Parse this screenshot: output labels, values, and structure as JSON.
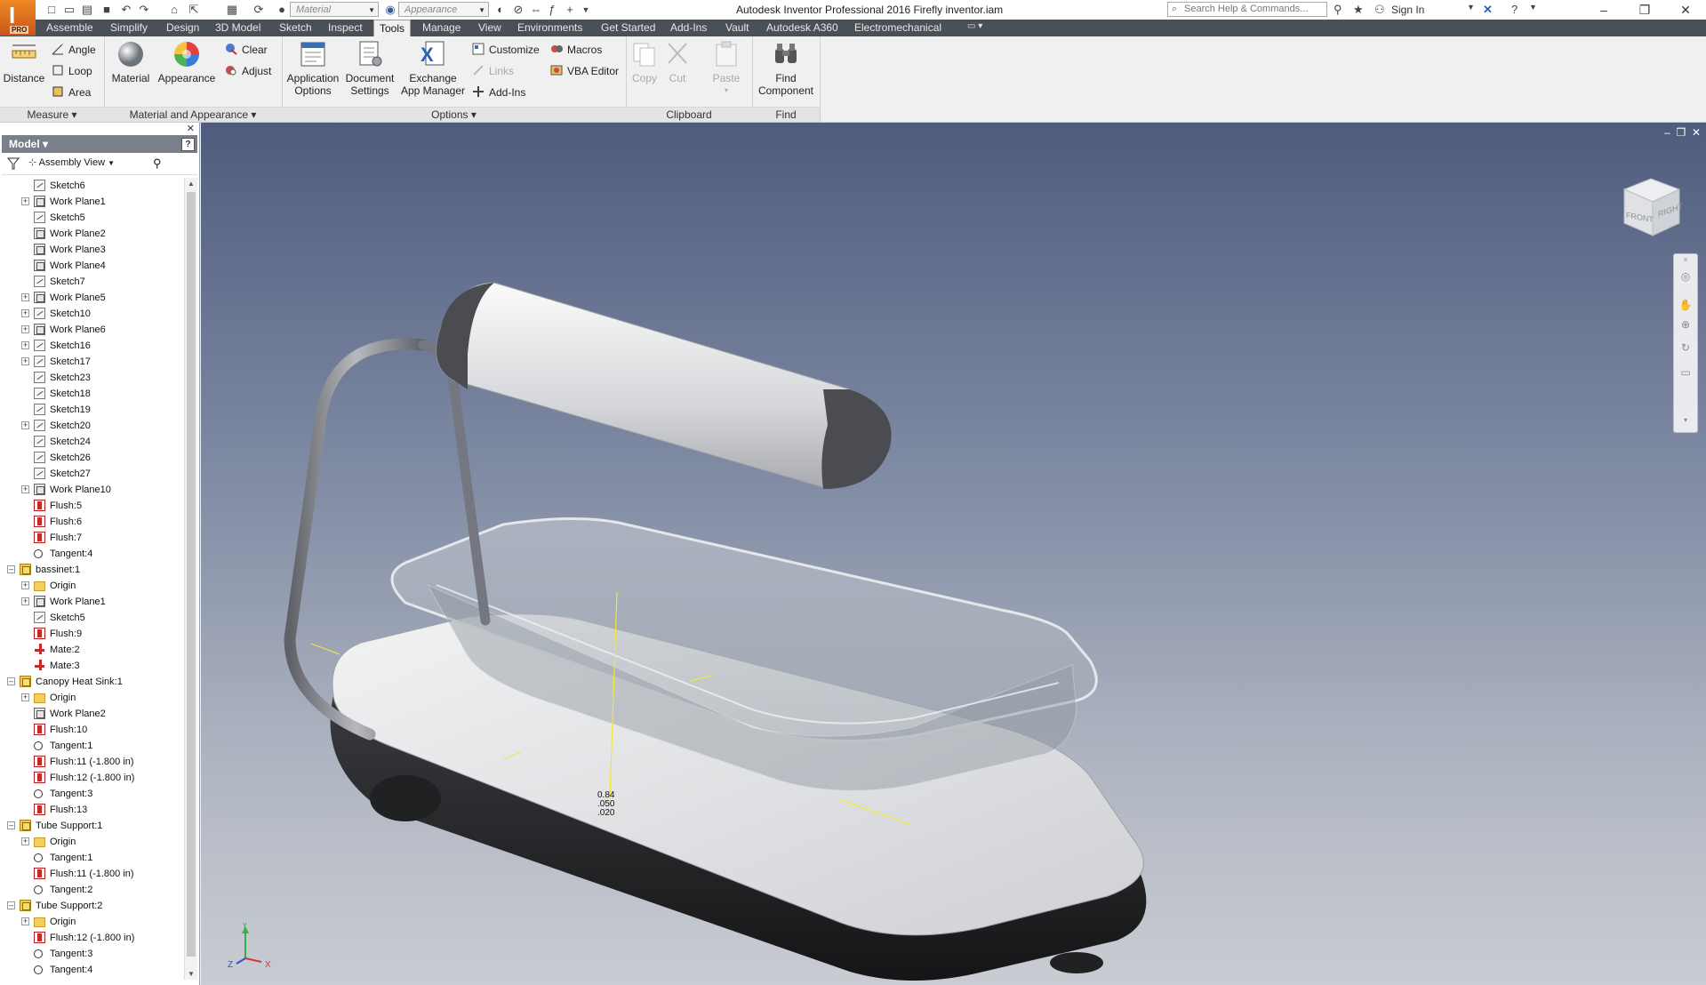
{
  "title_bar": {
    "app_title": "Autodesk Inventor Professional 2016   Firefly inventor.iam",
    "logo_letter": "I",
    "logo_badge": "PRO",
    "material_combo": "Material",
    "appearance_combo": "Appearance",
    "search_placeholder": "Search Help & Commands...",
    "sign_in": "Sign In"
  },
  "tabs": [
    {
      "label": "Assemble"
    },
    {
      "label": "Simplify"
    },
    {
      "label": "Design"
    },
    {
      "label": "3D Model"
    },
    {
      "label": "Sketch"
    },
    {
      "label": "Inspect"
    },
    {
      "label": "Tools"
    },
    {
      "label": "Manage"
    },
    {
      "label": "View"
    },
    {
      "label": "Environments"
    },
    {
      "label": "Get Started"
    },
    {
      "label": "Add-Ins"
    },
    {
      "label": "Vault"
    },
    {
      "label": "Autodesk A360"
    },
    {
      "label": "Electromechanical"
    }
  ],
  "active_tab": "Tools",
  "ribbon": {
    "measure": {
      "title": "Measure",
      "distance": "Distance",
      "angle": "Angle",
      "loop": "Loop",
      "area": "Area"
    },
    "material_appearance": {
      "title": "Material and Appearance",
      "material": "Material",
      "appearance": "Appearance",
      "clear": "Clear",
      "adjust": "Adjust"
    },
    "options": {
      "title": "Options",
      "application_options_1": "Application",
      "application_options_2": "Options",
      "document_settings_1": "Document",
      "document_settings_2": "Settings",
      "exchange_1": "Exchange",
      "exchange_2": "App Manager",
      "customize": "Customize",
      "links": "Links",
      "addins": "Add-Ins",
      "macros": "Macros",
      "vba": "VBA Editor"
    },
    "clipboard": {
      "title": "Clipboard",
      "copy": "Copy",
      "cut": "Cut",
      "paste": "Paste"
    },
    "find": {
      "title": "Find",
      "find_1": "Find",
      "find_2": "Component"
    }
  },
  "browser": {
    "header": "Model",
    "view": "Assembly View",
    "tree": [
      {
        "label": "Sketch6",
        "icon": "sketch",
        "indent": 1,
        "expand": false
      },
      {
        "label": "Work Plane1",
        "icon": "plane",
        "indent": 1,
        "expand": true
      },
      {
        "label": "Sketch5",
        "icon": "sketch",
        "indent": 1,
        "expand": false
      },
      {
        "label": "Work Plane2",
        "icon": "plane",
        "indent": 1,
        "expand": false
      },
      {
        "label": "Work Plane3",
        "icon": "plane",
        "indent": 1,
        "expand": false
      },
      {
        "label": "Work Plane4",
        "icon": "plane",
        "indent": 1,
        "expand": false
      },
      {
        "label": "Sketch7",
        "icon": "sketch",
        "indent": 1,
        "expand": false
      },
      {
        "label": "Work Plane5",
        "icon": "plane",
        "indent": 1,
        "expand": true
      },
      {
        "label": "Sketch10",
        "icon": "sketch",
        "indent": 1,
        "expand": true
      },
      {
        "label": "Work Plane6",
        "icon": "plane",
        "indent": 1,
        "expand": true
      },
      {
        "label": "Sketch16",
        "icon": "sketch",
        "indent": 1,
        "expand": true
      },
      {
        "label": "Sketch17",
        "icon": "sketch",
        "indent": 1,
        "expand": true
      },
      {
        "label": "Sketch23",
        "icon": "sketch",
        "indent": 1,
        "expand": false
      },
      {
        "label": "Sketch18",
        "icon": "sketch",
        "indent": 1,
        "expand": false
      },
      {
        "label": "Sketch19",
        "icon": "sketch",
        "indent": 1,
        "expand": false
      },
      {
        "label": "Sketch20",
        "icon": "sketch",
        "indent": 1,
        "expand": true
      },
      {
        "label": "Sketch24",
        "icon": "sketch",
        "indent": 1,
        "expand": false
      },
      {
        "label": "Sketch26",
        "icon": "sketch",
        "indent": 1,
        "expand": false
      },
      {
        "label": "Sketch27",
        "icon": "sketch",
        "indent": 1,
        "expand": false
      },
      {
        "label": "Work Plane10",
        "icon": "plane",
        "indent": 1,
        "expand": true
      },
      {
        "label": "Flush:5",
        "icon": "flush",
        "indent": 1,
        "expand": false
      },
      {
        "label": "Flush:6",
        "icon": "flush",
        "indent": 1,
        "expand": false
      },
      {
        "label": "Flush:7",
        "icon": "flush",
        "indent": 1,
        "expand": false
      },
      {
        "label": "Tangent:4",
        "icon": "tangent",
        "indent": 1,
        "expand": false
      },
      {
        "label": "bassinet:1",
        "icon": "part",
        "indent": 0,
        "expand": "minus"
      },
      {
        "label": "Origin",
        "icon": "folder",
        "indent": 1,
        "expand": true
      },
      {
        "label": "Work Plane1",
        "icon": "plane",
        "indent": 1,
        "expand": true
      },
      {
        "label": "Sketch5",
        "icon": "sketch",
        "indent": 1,
        "expand": false
      },
      {
        "label": "Flush:9",
        "icon": "flush",
        "indent": 1,
        "expand": false
      },
      {
        "label": "Mate:2",
        "icon": "mate",
        "indent": 1,
        "expand": false
      },
      {
        "label": "Mate:3",
        "icon": "mate",
        "indent": 1,
        "expand": false
      },
      {
        "label": "Canopy Heat Sink:1",
        "icon": "part",
        "indent": 0,
        "expand": "minus"
      },
      {
        "label": "Origin",
        "icon": "folder",
        "indent": 1,
        "expand": true
      },
      {
        "label": "Work Plane2",
        "icon": "plane",
        "indent": 1,
        "expand": false
      },
      {
        "label": "Flush:10",
        "icon": "flush",
        "indent": 1,
        "expand": false
      },
      {
        "label": "Tangent:1",
        "icon": "tangent",
        "indent": 1,
        "expand": false
      },
      {
        "label": "Flush:11 (-1.800 in)",
        "icon": "flush",
        "indent": 1,
        "expand": false
      },
      {
        "label": "Flush:12 (-1.800 in)",
        "icon": "flush",
        "indent": 1,
        "expand": false
      },
      {
        "label": "Tangent:3",
        "icon": "tangent",
        "indent": 1,
        "expand": false
      },
      {
        "label": "Flush:13",
        "icon": "flush",
        "indent": 1,
        "expand": false
      },
      {
        "label": "Tube Support:1",
        "icon": "part",
        "indent": 0,
        "expand": "minus"
      },
      {
        "label": "Origin",
        "icon": "folder",
        "indent": 1,
        "expand": true
      },
      {
        "label": "Tangent:1",
        "icon": "tangent",
        "indent": 1,
        "expand": false
      },
      {
        "label": "Flush:11 (-1.800 in)",
        "icon": "flush",
        "indent": 1,
        "expand": false
      },
      {
        "label": "Tangent:2",
        "icon": "tangent",
        "indent": 1,
        "expand": false
      },
      {
        "label": "Tube Support:2",
        "icon": "part",
        "indent": 0,
        "expand": "minus"
      },
      {
        "label": "Origin",
        "icon": "folder",
        "indent": 1,
        "expand": true
      },
      {
        "label": "Flush:12 (-1.800 in)",
        "icon": "flush",
        "indent": 1,
        "expand": false
      },
      {
        "label": "Tangent:3",
        "icon": "tangent",
        "indent": 1,
        "expand": false
      },
      {
        "label": "Tangent:4",
        "icon": "tangent",
        "indent": 1,
        "expand": false
      }
    ]
  },
  "viewport": {
    "viewcube_front": "FRONT",
    "viewcube_right": "RIGHT",
    "dimension_text": [
      "0.84",
      ".050",
      ".020"
    ],
    "axis_labels": {
      "x": "X",
      "y": "Y",
      "z": "Z"
    }
  },
  "colors": {
    "tab_bar": "#4b4f56",
    "accent_orange": "#f08a24",
    "browser_header": "#7a8089",
    "viewport_top": "#4f5c7d",
    "viewport_bottom": "#c9ccd2"
  }
}
